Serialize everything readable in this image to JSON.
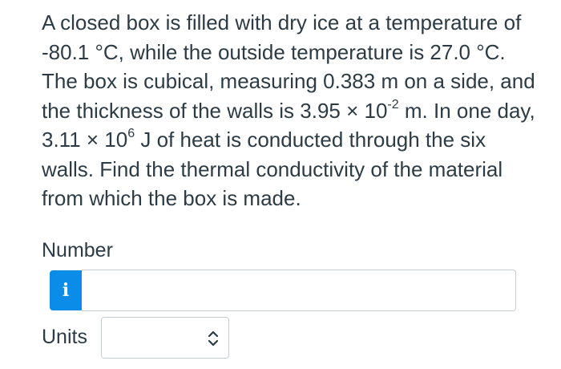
{
  "question": {
    "line1": "A closed box is filled with dry ice at a temperature of",
    "line2": "-80.1 °C, while the outside temperature is 27.0 °C.",
    "line3": "The box is cubical, measuring 0.383 m on a side, and",
    "line4_pre": "the thickness of the walls is 3.95 × 10",
    "line4_exp": "-2",
    "line4_post": " m. In one day,",
    "line5_pre": "3.11 × 10",
    "line5_exp": "6",
    "line5_post": " J of heat is conducted through the six",
    "line6": "walls. Find the thermal conductivity of the material",
    "line7": "from which the box is made."
  },
  "answer": {
    "number_label": "Number",
    "info_icon": "i",
    "number_value": "",
    "units_label": "Units",
    "units_value": ""
  },
  "colors": {
    "text": "#2d3b45",
    "info_button": "#0b8ce9",
    "border": "#c7cdd1"
  },
  "icons": {
    "info": "info-icon",
    "units_toggle": "chevron-up-down-icon"
  }
}
